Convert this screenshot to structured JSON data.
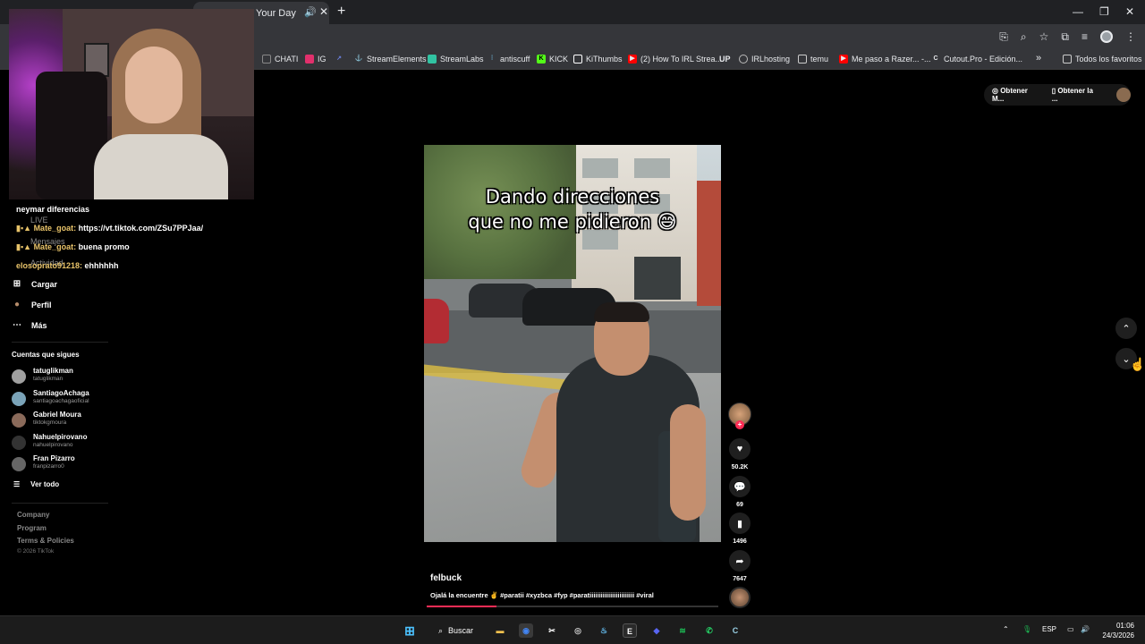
{
  "browser": {
    "tab_title": "Your Day",
    "speaker_glyph": "🔊",
    "close_glyph": "✕",
    "new_tab_glyph": "+",
    "window_controls": [
      "—",
      "❐",
      "✕"
    ],
    "bookmarks": [
      {
        "label": "CHATI",
        "icon": "instagram-like-icon",
        "color": "#888888"
      },
      {
        "label": "IG",
        "icon": "instagram-icon",
        "color": "#e1306c"
      },
      {
        "label": "",
        "icon": "chart-icon",
        "color": "#6a7fdb"
      },
      {
        "label": "StreamElements",
        "icon": "streamelements-icon",
        "color": "#ffffff"
      },
      {
        "label": "StreamLabs",
        "icon": "streamlabs-icon",
        "color": "#31c3a2"
      },
      {
        "label": "antiscuff",
        "icon": "antiscuff-icon",
        "color": "#7dd3fc"
      },
      {
        "label": "KICK",
        "icon": "kick-icon",
        "color": "#53fc18"
      },
      {
        "label": "KiThumbs",
        "icon": "kithumbs-icon",
        "color": "#ffffff"
      },
      {
        "label": "(2) How To IRL Strea...",
        "icon": "youtube-icon",
        "color": "#ff0000"
      },
      {
        "label": "UP",
        "icon": "",
        "color": "#ffffff"
      },
      {
        "label": "IRLhosting",
        "icon": "globe-icon",
        "color": "#bbbbbb"
      },
      {
        "label": "temu",
        "icon": "folder-icon",
        "color": "#cccccc"
      },
      {
        "label": "Me paso a Razer... -...",
        "icon": "youtube-icon",
        "color": "#ff0000"
      },
      {
        "label": "Cutout.Pro - Edición...",
        "icon": "cutout-icon",
        "color": "#ffffff"
      }
    ],
    "more_bookmarks": "»",
    "all_favorites": "Todos los favoritos"
  },
  "chat": {
    "partial_line": "neymar diferencias",
    "messages": [
      {
        "user": "Mate_goat:",
        "text": "https://vt.tiktok.com/ZSu7PPJaa/"
      },
      {
        "user": "Mate_goat:",
        "text": "buena promo"
      },
      {
        "user": "elosoprato91218:",
        "text": "ehhhhhh"
      }
    ]
  },
  "sidebar": {
    "ghost_items": [
      "LIVE",
      "Mensajes",
      "Actividad"
    ],
    "nav": [
      {
        "label": "Cargar",
        "icon": "upload-icon",
        "glyph": "⊞"
      },
      {
        "label": "Perfil",
        "icon": "profile-avatar-icon",
        "glyph": "●"
      },
      {
        "label": "Más",
        "icon": "more-icon",
        "glyph": "⋯"
      }
    ],
    "following_header": "Cuentas que sigues",
    "accounts": [
      {
        "name": "tatuglikman",
        "handle": "tatuglikman",
        "color": "#a0a0a0"
      },
      {
        "name": "SantiagoAchaga",
        "handle": "santiagoachagaoficial",
        "color": "#7aa3b8"
      },
      {
        "name": "Gabriel Moura",
        "handle": "tiktokgmoura",
        "color": "#8a6a5a"
      },
      {
        "name": "Nahuelpirovano",
        "handle": "nahuelpirovano",
        "color": "#333333"
      },
      {
        "name": "Fran Pizarro",
        "handle": "franpizarro0",
        "color": "#666666"
      }
    ],
    "see_all": "Ver todo",
    "footer": [
      "Company",
      "Program",
      "Terms & Policies"
    ],
    "copyright": "© 2026 TikTok"
  },
  "top_actions": {
    "get_app_1": "Obtener M...",
    "get_app_2": "Obtener la ..."
  },
  "video": {
    "caption_line1": "Dando direcciones",
    "caption_line2": "que no me pidieron 😅",
    "creator": "felbuck",
    "description": "Ojalá la encuentre ✌️ #paratii #xyzbca #fyp #paratiiiiiiiiiiiiiiiiiiiiiiii #viral",
    "progress": 0.24,
    "likes": "50.2K",
    "comments": "69",
    "saves": "1496",
    "shares": "7647"
  },
  "taskbar": {
    "search_label": "Buscar",
    "lang": "ESP",
    "time": "01:06",
    "date": "24/3/2026",
    "apps": [
      {
        "icon": "file-explorer-icon",
        "color": "#f2c14e",
        "glyph": "▬"
      },
      {
        "icon": "chrome-icon",
        "color": "#4285f4",
        "glyph": "◉"
      },
      {
        "icon": "capcut-icon",
        "color": "#ffffff",
        "glyph": "✂"
      },
      {
        "icon": "obs-icon",
        "color": "#cccccc",
        "glyph": "◎"
      },
      {
        "icon": "steam-icon",
        "color": "#66c0f4",
        "glyph": "♨"
      },
      {
        "icon": "epic-games-icon",
        "color": "#2a2a2a",
        "glyph": "E"
      },
      {
        "icon": "discord-icon",
        "color": "#5865f2",
        "glyph": "◆"
      },
      {
        "icon": "spotify-icon",
        "color": "#1db954",
        "glyph": "≋"
      },
      {
        "icon": "whatsapp-icon",
        "color": "#25d366",
        "glyph": "✆"
      },
      {
        "icon": "cursor-app-icon",
        "color": "#9ad1e6",
        "glyph": "C"
      }
    ]
  }
}
